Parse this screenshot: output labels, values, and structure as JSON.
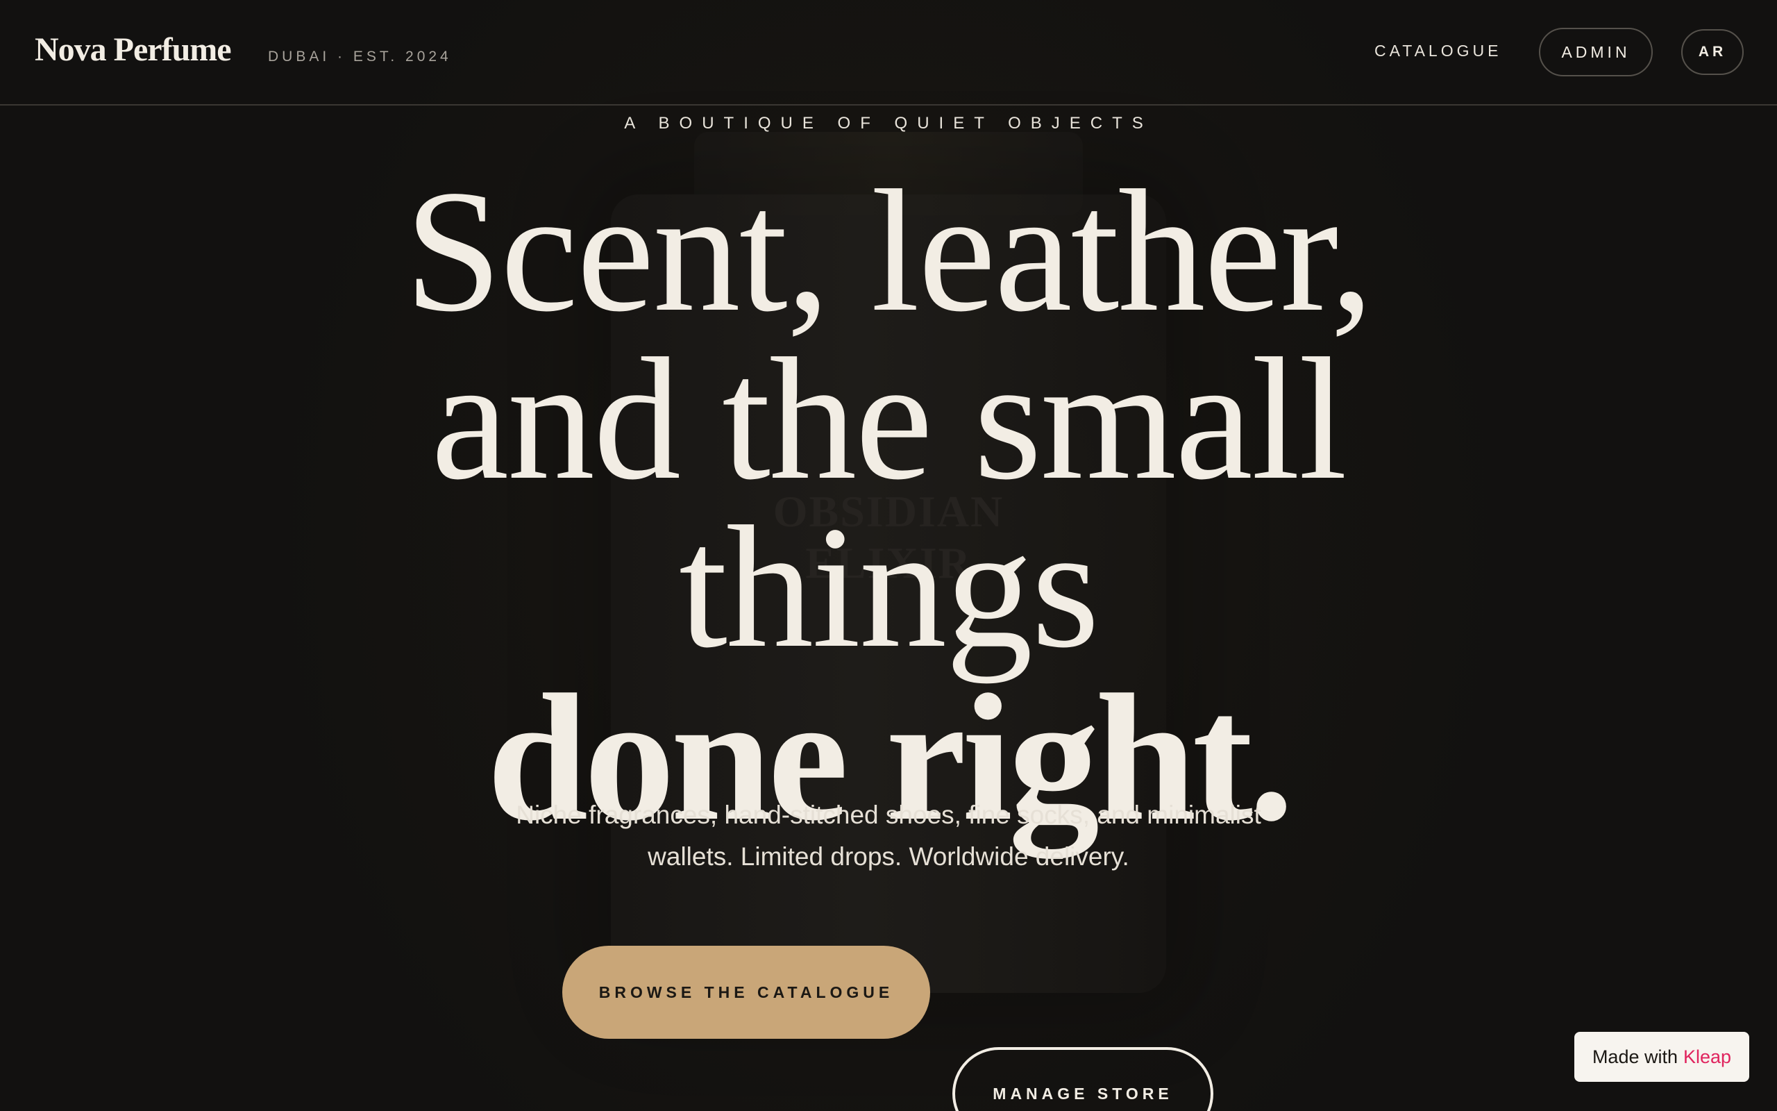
{
  "header": {
    "brand": "Nova Perfume",
    "tagline": "DUBAI · EST. 2024",
    "nav_catalogue": "CATALOGUE",
    "nav_admin": "ADMIN",
    "nav_language": "AR"
  },
  "hero": {
    "eyebrow": "A BOUTIQUE OF QUIET OBJECTS",
    "headline_line1": "Scent, leather,",
    "headline_line2": "and the small",
    "headline_line3": "things",
    "headline_line4": "done right.",
    "subtext": "Niche fragrances, hand-stitched shoes, fine socks, and minimalist wallets. Limited drops. Worldwide delivery.",
    "bottle_label_line1": "OBSIDIAN",
    "bottle_label_line2": "ELIXIR",
    "cta_primary": "BROWSE THE CATALOGUE",
    "cta_secondary": "MANAGE STORE"
  },
  "badge": {
    "prefix": "Made with",
    "brand": "Kleap"
  },
  "colors": {
    "background": "#151310",
    "text": "#f2ede4",
    "accent": "#c9a678",
    "badge_brand": "#e0245e"
  }
}
